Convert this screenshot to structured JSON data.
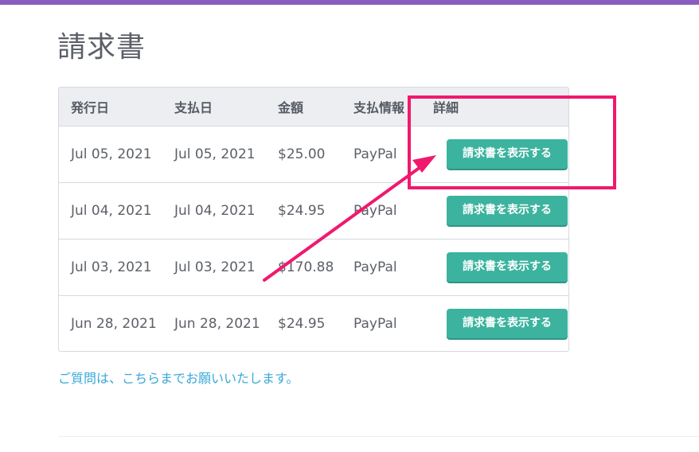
{
  "page": {
    "title": "請求書",
    "contact_link": "ご質問は、こちらまでお願いいたします。"
  },
  "table": {
    "headers": [
      "発行日",
      "支払日",
      "金額",
      "支払情報",
      "詳細"
    ],
    "rows": [
      {
        "issued": "Jul 05, 2021",
        "paid": "Jul 05, 2021",
        "amount": "$25.00",
        "method": "PayPal",
        "action": "請求書を表示する"
      },
      {
        "issued": "Jul 04, 2021",
        "paid": "Jul 04, 2021",
        "amount": "$24.95",
        "method": "PayPal",
        "action": "請求書を表示する"
      },
      {
        "issued": "Jul 03, 2021",
        "paid": "Jul 03, 2021",
        "amount": "$170.88",
        "method": "PayPal",
        "action": "請求書を表示する"
      },
      {
        "issued": "Jun 28, 2021",
        "paid": "Jun 28, 2021",
        "amount": "$24.95",
        "method": "PayPal",
        "action": "請求書を表示する"
      }
    ]
  },
  "colors": {
    "accent_bar": "#8a5cc0",
    "button": "#3cb39e",
    "link": "#3aa8d8",
    "annotation": "#f0196e"
  }
}
